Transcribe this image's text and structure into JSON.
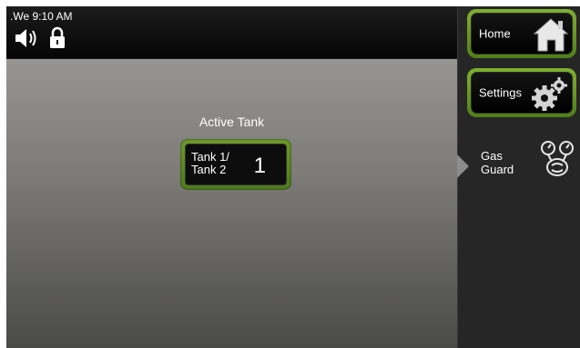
{
  "status": {
    "time": ".We 9:10 AM",
    "icons": [
      "speaker-icon",
      "lock-icon"
    ]
  },
  "main": {
    "active_tank_label": "Active Tank",
    "tank_button": {
      "name_line1": "Tank 1/",
      "name_line2": "Tank 2",
      "value": "1"
    }
  },
  "sidebar": {
    "home_label": "Home",
    "settings_label": "Settings",
    "gas_guard_line1": "Gas",
    "gas_guard_line2": "Guard",
    "icons": [
      "home-icon",
      "settings-gears-icon",
      "gas-guard-icon"
    ]
  },
  "colors": {
    "accent_green": "#6e9a2a",
    "panel_dark": "#262626"
  }
}
